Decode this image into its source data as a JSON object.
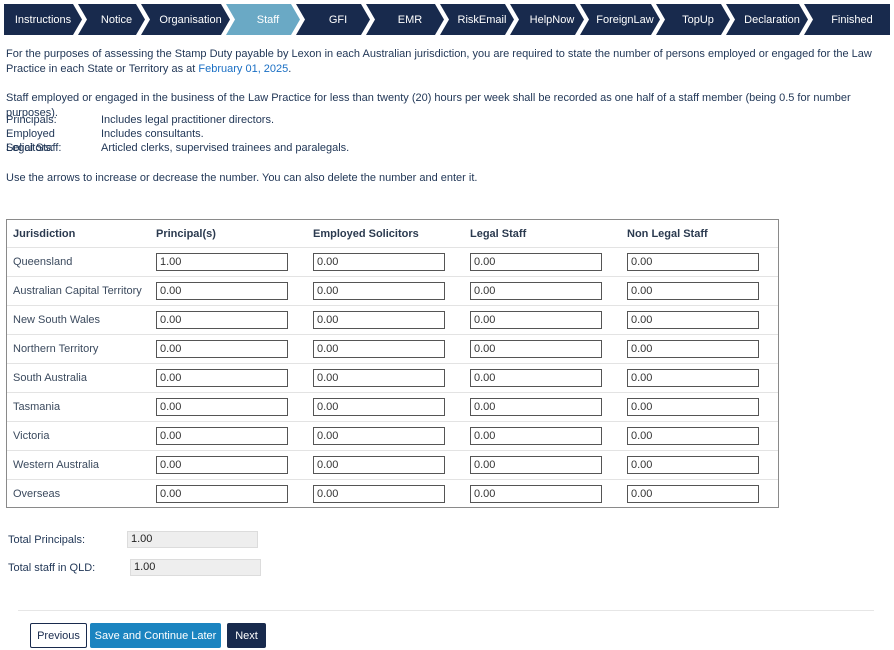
{
  "steps": [
    {
      "label": "Instructions",
      "active": false
    },
    {
      "label": "Notice",
      "active": false
    },
    {
      "label": "Organisation",
      "active": false
    },
    {
      "label": "Staff",
      "active": true
    },
    {
      "label": "GFI",
      "active": false
    },
    {
      "label": "EMR",
      "active": false
    },
    {
      "label": "RiskEmail",
      "active": false
    },
    {
      "label": "HelpNow",
      "active": false
    },
    {
      "label": "ForeignLaw",
      "active": false
    },
    {
      "label": "TopUp",
      "active": false
    },
    {
      "label": "Declaration",
      "active": false
    },
    {
      "label": "Finished",
      "active": false
    }
  ],
  "intro": {
    "text": "For the purposes of assessing the Stamp Duty payable by Lexon in each Australian jurisdiction, you are required to state the number of persons employed or engaged for the Law Practice in each State or Territory as at ",
    "date": "February 01, 2025",
    "suffix": "."
  },
  "half_note": "Staff employed or engaged in the business of the Law Practice for less than twenty (20) hours per week shall be recorded as one half of a staff member (being 0.5 for number purposes).",
  "definitions": [
    {
      "term": "Principals:",
      "desc": "Includes legal practitioner directors."
    },
    {
      "term": "Employed Solicitors:",
      "desc": "Includes consultants."
    },
    {
      "term": "Legal Staff:",
      "desc": "Articled clerks, supervised trainees and paralegals."
    }
  ],
  "arrows_note": "Use the arrows to increase or decrease the number. You can also delete the number and enter it.",
  "table": {
    "headers": [
      "Jurisdiction",
      "Principal(s)",
      "Employed Solicitors",
      "Legal Staff",
      "Non Legal Staff"
    ],
    "rows": [
      {
        "jurisdiction": "Queensland",
        "values": [
          "1.00",
          "0.00",
          "0.00",
          "0.00"
        ]
      },
      {
        "jurisdiction": "Australian Capital Territory",
        "values": [
          "0.00",
          "0.00",
          "0.00",
          "0.00"
        ]
      },
      {
        "jurisdiction": "New South Wales",
        "values": [
          "0.00",
          "0.00",
          "0.00",
          "0.00"
        ]
      },
      {
        "jurisdiction": "Northern Territory",
        "values": [
          "0.00",
          "0.00",
          "0.00",
          "0.00"
        ]
      },
      {
        "jurisdiction": "South Australia",
        "values": [
          "0.00",
          "0.00",
          "0.00",
          "0.00"
        ]
      },
      {
        "jurisdiction": "Tasmania",
        "values": [
          "0.00",
          "0.00",
          "0.00",
          "0.00"
        ]
      },
      {
        "jurisdiction": "Victoria",
        "values": [
          "0.00",
          "0.00",
          "0.00",
          "0.00"
        ]
      },
      {
        "jurisdiction": "Western Australia",
        "values": [
          "0.00",
          "0.00",
          "0.00",
          "0.00"
        ]
      },
      {
        "jurisdiction": "Overseas",
        "values": [
          "0.00",
          "0.00",
          "0.00",
          "0.00"
        ]
      }
    ]
  },
  "totals": {
    "principals_label": "Total Principals:",
    "principals_value": "1.00",
    "qld_label": "Total staff in QLD:",
    "qld_value": "1.00"
  },
  "buttons": {
    "previous": "Previous",
    "save": "Save and Continue Later",
    "next": "Next"
  },
  "colors": {
    "step_bg": "#182a4d",
    "step_active": "#6aa9c5",
    "link": "#1a6fc4",
    "save_button": "#1b84c0"
  }
}
